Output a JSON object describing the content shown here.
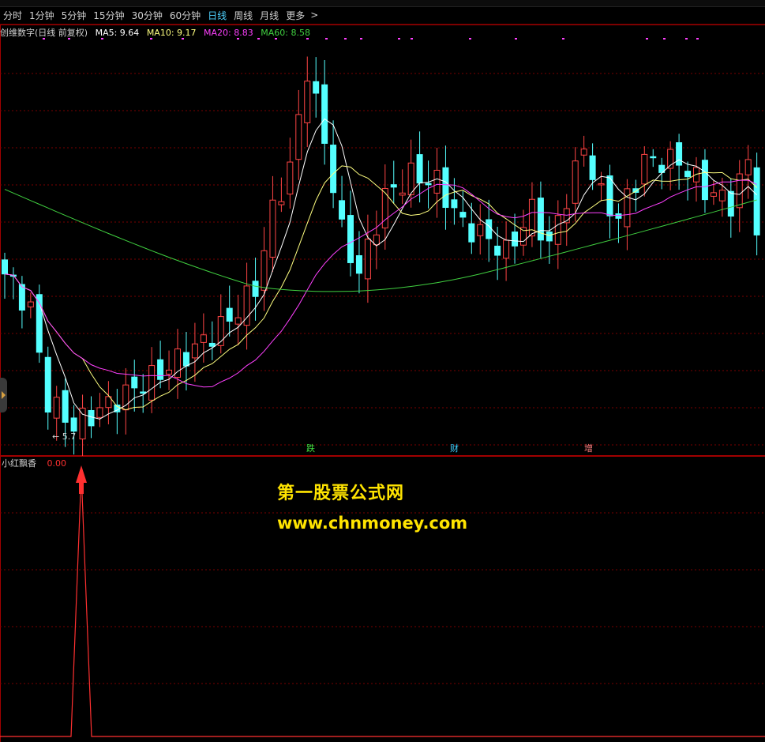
{
  "period_bar": {
    "items": [
      "分时",
      "1分钟",
      "5分钟",
      "15分钟",
      "30分钟",
      "60分钟",
      "日线",
      "周线",
      "月线",
      "更多"
    ],
    "active": "日线"
  },
  "main_info": {
    "title": "创维数字(日线 前复权)",
    "ma5": "MA5: 9.64",
    "ma10": "MA10: 9.17",
    "ma20": "MA20: 8.83",
    "ma60": "MA60: 8.58"
  },
  "colors": {
    "up": "#ff4545",
    "down": "#54ffff",
    "ma5": "#ffffff",
    "ma10": "#ffff80",
    "ma20": "#ff40ff",
    "ma60": "#40d040",
    "grid": "#7a0000",
    "frame": "#a00000",
    "signal": "#ff3030"
  },
  "low_marker": "5.7",
  "events": [
    {
      "label": "跌",
      "color": "#40e040"
    },
    {
      "label": "财",
      "color": "#40d0ff"
    },
    {
      "label": "增",
      "color": "#ff8080"
    }
  ],
  "indicator": {
    "name": "小红飘香",
    "value": "0.00"
  },
  "watermark": {
    "title": "第一股票公式网",
    "url": "www.chnmoney.com"
  },
  "chart_data": {
    "type": "candlestick",
    "series": [
      {
        "name": "MA5",
        "value": 9.64
      },
      {
        "name": "MA10",
        "value": 9.17
      },
      {
        "name": "MA20",
        "value": 8.83
      },
      {
        "name": "MA60",
        "value": 8.58
      }
    ],
    "annotations": [
      "5.7"
    ],
    "indicator_series": {
      "name": "小红飘香",
      "last_value": 0.0,
      "spike_count": 1
    }
  }
}
